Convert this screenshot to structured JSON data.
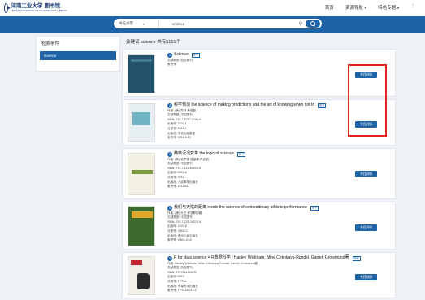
{
  "header": {
    "logo_main": "河南工业大学 图书馆",
    "logo_sub": "HENAN UNIVERSITY OF TECHNOLOGY LIBRARY",
    "nav": [
      "首页",
      "资源导航 ▾",
      "特色专题 ▾",
      "⋮"
    ]
  },
  "search": {
    "scope": "书名关键",
    "query": "science"
  },
  "sidebar": {
    "title": "检索条件",
    "active_filter": "science"
  },
  "results_header": "关键词 science 共有5151个",
  "results": [
    {
      "index": "1",
      "title": "Science",
      "badge": "图书",
      "meta": [
        "文献类型: 西文期刊",
        "索书号:"
      ],
      "button": "书目详情",
      "cover": {
        "color": "#23516b",
        "accent": "#3b7d8f",
        "label": "SCIENCE"
      }
    },
    {
      "index": "2",
      "title": "科学预测 the science of making predictions and the art of knowing when not to",
      "badge": "图书",
      "meta": [
        "作者: (美) 森林 斯普曼",
        "文献类型: 中文图书",
        "ISBN: 978-7-5217-6196-9",
        "出版年: 2024.1",
        "分类号: 0211.1",
        "出版社: 中信出版集团",
        "索书号: 0211.1/13"
      ],
      "button": "书目详情",
      "cover": {
        "color": "#e8f0f3",
        "accent": "#6fb3c4",
        "label": "科学预测"
      }
    },
    {
      "index": "3",
      "title": "精英近况变革 the logic of science",
      "badge": "图书",
      "meta": [
        "作者: (美) 哈罗德·洛豪森·杰克逊",
        "文献类型: 中文图书",
        "ISBN: 978-7-115-64026-5",
        "出版年: 2024.8",
        "分类号: 0211",
        "出版社: 人民邮电出版社",
        "索书号: 0211/81"
      ],
      "button": "书目详情",
      "cover": {
        "color": "#f4f1e4",
        "accent": "#7a9a3c",
        "label": "概率论沉思录"
      }
    },
    {
      "index": "4",
      "title": "我们与天赋的距离 inside the science of extraordinary athletic performance",
      "badge": "图书",
      "meta": [
        "作者: (美) 大卫 爱泼斯坦著",
        "文献类型: 中文图书",
        "ISBN: 978-7-221-18215-9",
        "出版年: 2024.6",
        "分类号: G804.2",
        "出版社: 贵州人民出版社",
        "索书号: G804.2/16"
      ],
      "button": "书目详情",
      "cover": {
        "color": "#3d6b2f",
        "accent": "#e0a82a",
        "label": "运动基因"
      }
    },
    {
      "index": "5",
      "title": "R for data science = R数据科学 / Hadley Wickham, Mine Cetinkaya-Rundel, Garrett Grolemund著",
      "badge": "图书",
      "meta": [
        "作者: Hadley Wickham, Mine Cetinkaya-Rundel, Garrett Grolemund著",
        "文献类型: 西文图书",
        "ISBN: 9787564119892",
        "出版年: 2024",
        "分类号: TP312",
        "出版社: 东南大学出版社",
        "索书号: TP312/E213.2"
      ],
      "button": "书目详情",
      "cover": {
        "color": "#f2efe8",
        "accent": "#c4242f",
        "label": "R for Data Science"
      }
    }
  ]
}
